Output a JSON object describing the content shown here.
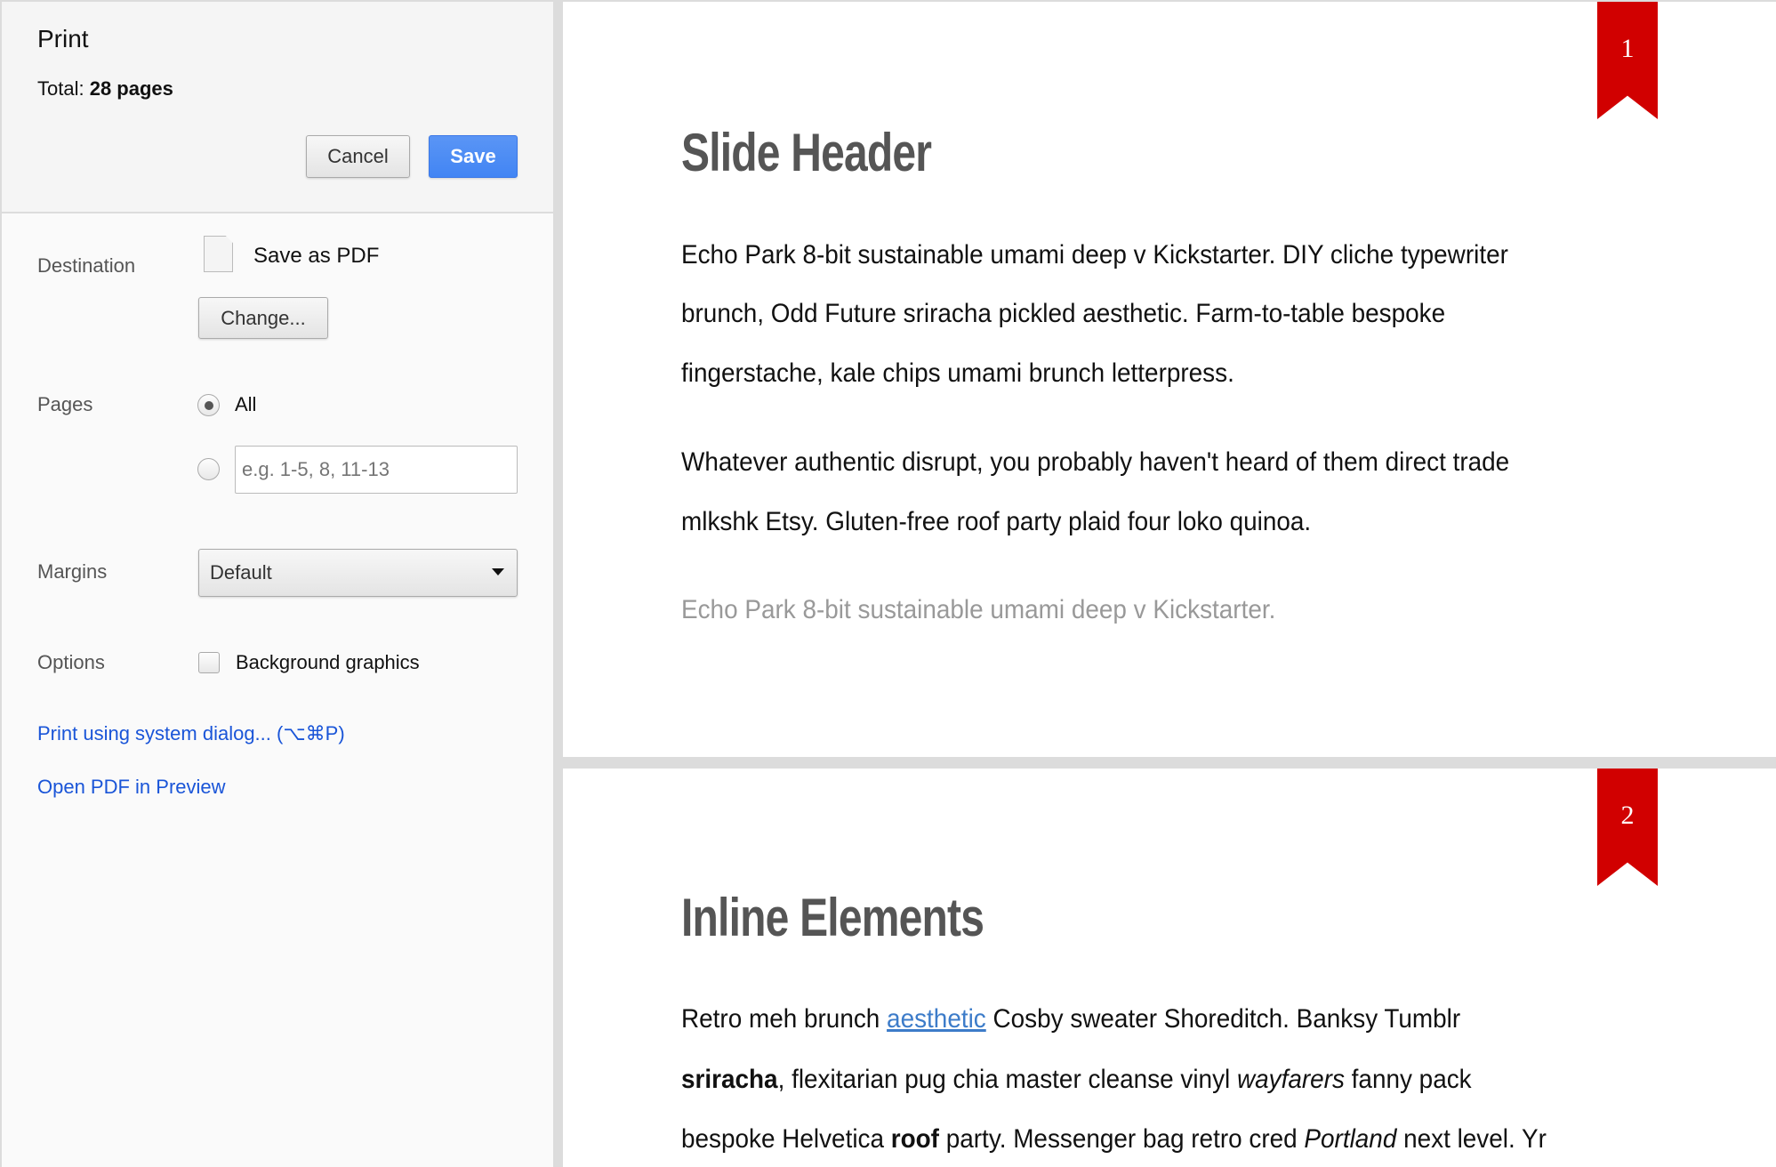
{
  "sidebar": {
    "title": "Print",
    "total_label": "Total:",
    "total_value": "28 pages",
    "cancel": "Cancel",
    "save": "Save",
    "destination": {
      "label": "Destination",
      "value": "Save as PDF",
      "change": "Change..."
    },
    "pages": {
      "label": "Pages",
      "all": "All",
      "all_selected": true,
      "range_placeholder": "e.g. 1-5, 8, 11-13"
    },
    "margins": {
      "label": "Margins",
      "value": "Default"
    },
    "options": {
      "label": "Options",
      "background_graphics": "Background graphics",
      "checked": false
    },
    "links": [
      "Print using system dialog... (⌥⌘P)",
      "Open PDF in Preview"
    ]
  },
  "preview": {
    "accent": "#d10000",
    "page1": {
      "number": "1",
      "heading": "Slide Header",
      "p1": [
        "Echo Park 8-bit sustainable umami deep v Kickstarter. DIY cliche typewriter",
        "brunch, Odd Future sriracha pickled aesthetic. Farm-to-table bespoke",
        "fingerstache, kale chips umami brunch letterpress."
      ],
      "p2": [
        "Whatever authentic disrupt, you probably haven't heard of them direct trade",
        "mlkshk Etsy. Gluten-free roof party plaid four loko quinoa."
      ],
      "muted": "Echo Park 8-bit sustainable umami deep v Kickstarter."
    },
    "page2": {
      "number": "2",
      "heading": "Inline Elements",
      "l1": {
        "a": "Retro meh brunch ",
        "link": "aesthetic",
        "b": " Cosby sweater Shoreditch. Banksy Tumblr"
      },
      "l2": {
        "bold": "sriracha",
        "a": ", flexitarian pug chia master cleanse vinyl ",
        "italic": "wayfarers",
        "b": " fanny pack"
      },
      "l3": {
        "a": "bespoke Helvetica ",
        "bold": "roof",
        "b": " party. Messenger bag retro cred ",
        "italic": "Portland",
        "c": " next level. Yr"
      }
    }
  }
}
